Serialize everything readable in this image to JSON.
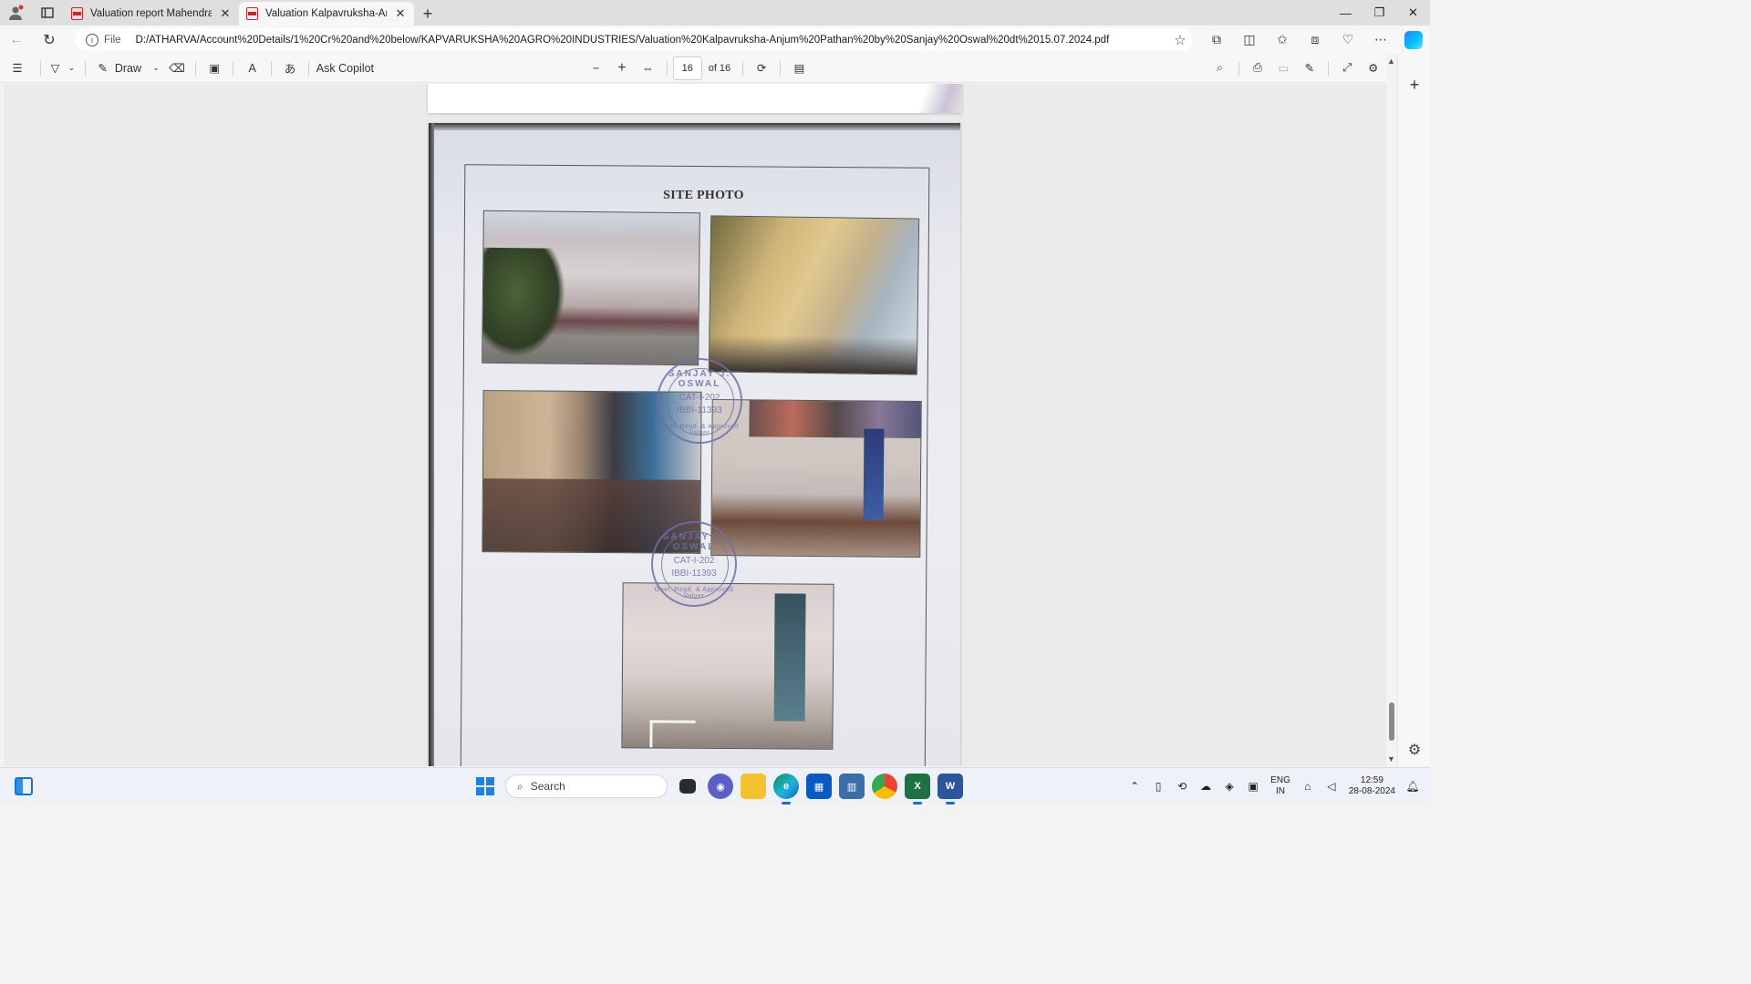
{
  "browser": {
    "tabs": [
      {
        "title": "Valuation report Mahendra Manc",
        "active": false
      },
      {
        "title": "Valuation Kalpavruksha-Anjum P",
        "active": true
      }
    ],
    "address": {
      "scheme_label": "File",
      "url": "D:/ATHARVA/Account%20Details/1%20Cr%20and%20below/KAPVARUKSHA%20AGRO%20INDUSTRIES/Valuation%20Kalpavruksha-Anjum%20Pathan%20by%20Sanjay%20Oswal%20dt%2015.07.2024.pdf"
    }
  },
  "pdf_toolbar": {
    "draw_label": "Draw",
    "ask_copilot_label": "Ask Copilot",
    "current_page": "16",
    "page_total": "of 16"
  },
  "document": {
    "page_title": "SITE PHOTO",
    "stamps": [
      {
        "name": "SANJAY J. OSWAL",
        "category": "CAT-I-202",
        "registration": "IBBI-11393",
        "footer": "Govt. Regd. & Approved Valuer"
      },
      {
        "name": "SANJAY J. OSWAL",
        "category": "CAT-I-202",
        "registration": "IBBI-11393",
        "footer": "Govt. Regd. & Approved Valuer"
      }
    ]
  },
  "taskbar": {
    "search_placeholder": "Search",
    "language": {
      "line1": "ENG",
      "line2": "IN"
    },
    "clock": {
      "time": "12:59",
      "date": "28-08-2024"
    }
  },
  "colors": {
    "accent": "#1a73c9",
    "pdf_icon": "#c8262c",
    "stamp_ink": "#6d6fa8"
  }
}
